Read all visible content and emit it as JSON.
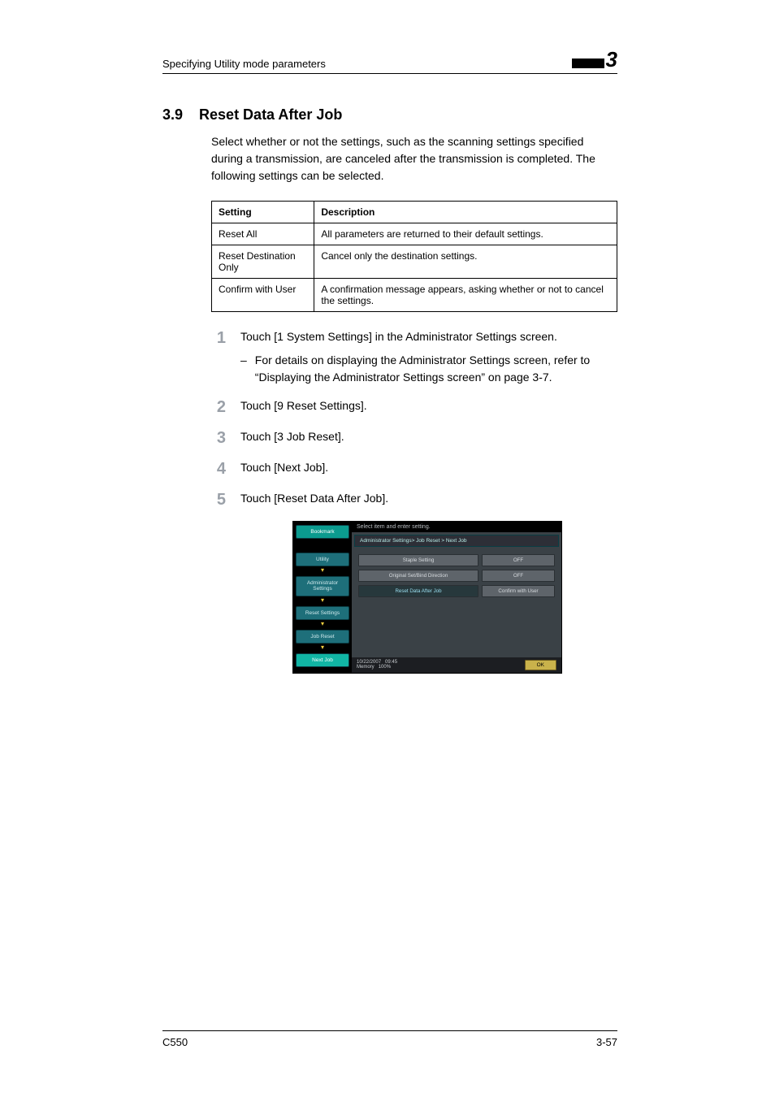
{
  "header": {
    "running_title": "Specifying Utility mode parameters",
    "chapter_number": "3"
  },
  "section": {
    "number": "3.9",
    "title": "Reset Data After Job",
    "intro": "Select whether or not the settings, such as the scanning settings specified during a transmission, are canceled after the transmission is completed. The following settings can be selected."
  },
  "table": {
    "head": {
      "c1": "Setting",
      "c2": "Description"
    },
    "rows": [
      {
        "c1": "Reset All",
        "c2": "All parameters are returned to their default settings."
      },
      {
        "c1": "Reset Destina­tion Only",
        "c2": "Cancel only the destination settings."
      },
      {
        "c1": "Confirm with User",
        "c2": "A confirmation message appears, asking whether or not to cancel the set­tings."
      }
    ]
  },
  "steps": [
    {
      "n": "1",
      "text": "Touch [1 System Settings] in the Administrator Settings screen.",
      "sub": "For details on displaying the Administrator Settings screen, refer to “Displaying the Administrator Settings screen” on page 3-7."
    },
    {
      "n": "2",
      "text": "Touch [9 Reset Settings]."
    },
    {
      "n": "3",
      "text": "Touch [3 Job Reset]."
    },
    {
      "n": "4",
      "text": "Touch [Next Job]."
    },
    {
      "n": "5",
      "text": "Touch [Reset Data After Job]."
    }
  ],
  "touchscreen": {
    "title": "Select item and enter setting.",
    "breadcrumb": "Administrator Settings> Job Reset > Next Job",
    "left_buttons": {
      "bookmark": "Bookmark",
      "utility": "Utility",
      "admin": "Administrator Settings",
      "reset": "Reset Settings",
      "jobreset": "Job Reset",
      "nextjob": "Next Job"
    },
    "rows": [
      {
        "label": "Staple Setting",
        "value": "OFF"
      },
      {
        "label": "Original Set/Bind Direction",
        "value": "OFF"
      },
      {
        "label": "Reset Data After Job",
        "value": "Confirm with User"
      }
    ],
    "footer": {
      "date": "10/22/2007",
      "time": "09:45",
      "mem_label": "Memory",
      "mem_val": "100%",
      "ok": "OK"
    }
  },
  "footer": {
    "model": "C550",
    "page": "3-57"
  }
}
